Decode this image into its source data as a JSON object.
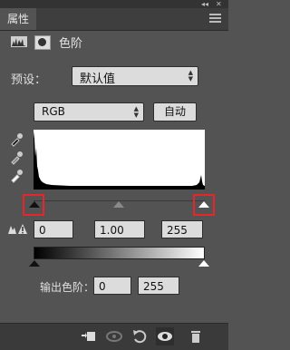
{
  "panel": {
    "tab_label": "属性",
    "title": "色阶"
  },
  "preset": {
    "label": "预设：",
    "value": "默认值"
  },
  "channel": {
    "value": "RGB"
  },
  "auto_button": {
    "label": "自动"
  },
  "input_levels": {
    "black": "0",
    "gamma": "1.00",
    "white": "255"
  },
  "output_levels": {
    "label": "输出色阶：",
    "black": "0",
    "white": "255"
  },
  "colors": {
    "panel_bg": "#535353",
    "highlight": "#e8262a"
  },
  "histogram": {
    "peak_at_left": true,
    "small_bump_at_right": true
  }
}
